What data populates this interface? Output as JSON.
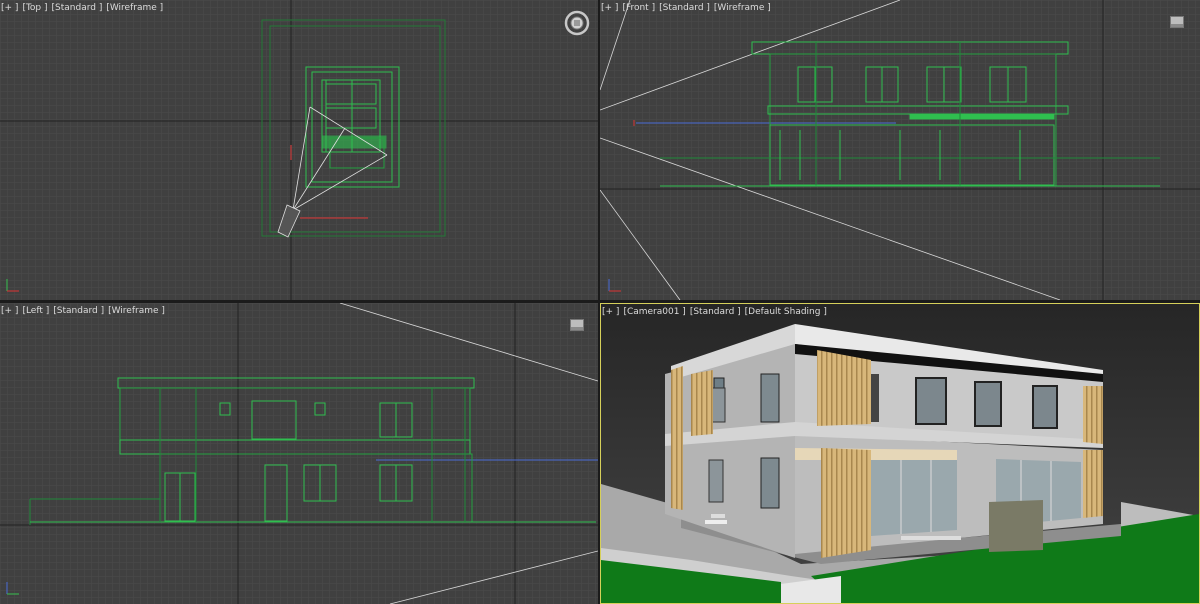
{
  "viewports": {
    "top": {
      "menu": "[+ ]",
      "view": "[Top ]",
      "mode": "[Standard ]",
      "shading": "[Wireframe ]"
    },
    "front": {
      "menu": "[+ ]",
      "view": "[Front ]",
      "mode": "[Standard ]",
      "shading": "[Wireframe ]"
    },
    "left": {
      "menu": "[+ ]",
      "view": "[Left ]",
      "mode": "[Standard ]",
      "shading": "[Wireframe ]"
    },
    "camera": {
      "menu": "[+ ]",
      "view": "[Camera001 ]",
      "mode": "[Standard ]",
      "shading": "[Default Shading ]"
    }
  },
  "icons": {
    "navcube": "viewcube-icon",
    "steering": "steering-wheel-icon",
    "axis": "axis-tripod-icon"
  },
  "colors": {
    "viewport_bg": "#404040",
    "wireframe": "#2fbf4f",
    "active_border": "#d6d05a",
    "label_text": "#dcdcdc"
  }
}
